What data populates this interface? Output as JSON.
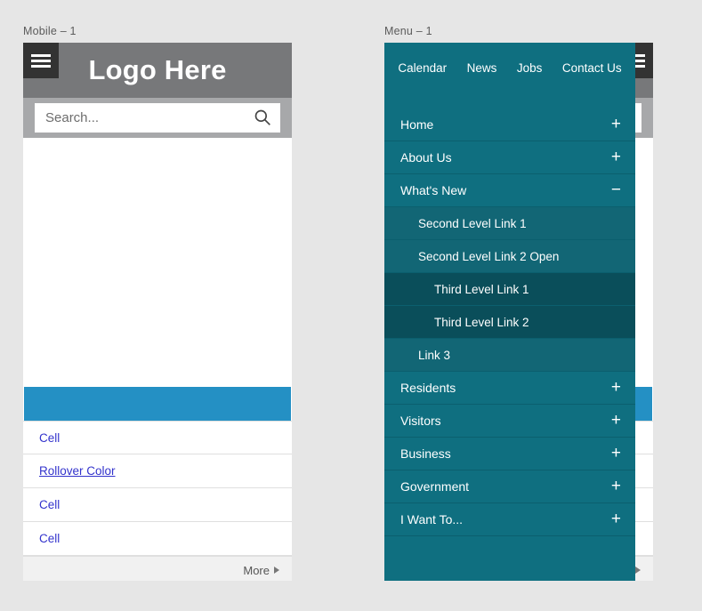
{
  "captions": {
    "mobile": "Mobile – 1",
    "menu": "Menu – 1"
  },
  "colors": {
    "teal": "#0f6f80",
    "teal_level2": "#126675",
    "teal_level3": "#0a4e5a",
    "header_gray": "#77787a",
    "search_band_gray": "#a7a8aa",
    "hamburger_dark": "#333333",
    "accent_blue": "#2490c4",
    "link_blue": "#3333cc",
    "page_bg": "#e6e6e6"
  },
  "mockup": {
    "hamburger_label": "menu",
    "logo": "Logo Here",
    "search": {
      "value": "",
      "placeholder": "Search..."
    },
    "cells": [
      {
        "label": "Cell",
        "rollover": false
      },
      {
        "label": "Rollover Color",
        "rollover": true
      },
      {
        "label": "Cell",
        "rollover": false
      },
      {
        "label": "Cell",
        "rollover": false
      }
    ],
    "more_label": "More"
  },
  "menu": {
    "top_links": [
      "Calendar",
      "News",
      "Jobs",
      "Contact Us"
    ],
    "items": [
      {
        "label": "Home",
        "level": 1,
        "toggle": "+"
      },
      {
        "label": "About Us",
        "level": 1,
        "toggle": "+"
      },
      {
        "label": "What's New",
        "level": 1,
        "toggle": "−"
      },
      {
        "label": "Second Level Link 1",
        "level": 2,
        "toggle": ""
      },
      {
        "label": "Second Level Link 2 Open",
        "level": 2,
        "toggle": ""
      },
      {
        "label": "Third Level Link 1",
        "level": 3,
        "toggle": ""
      },
      {
        "label": "Third Level Link 2",
        "level": 3,
        "toggle": ""
      },
      {
        "label": "Link 3",
        "level": 2,
        "toggle": ""
      },
      {
        "label": "Residents",
        "level": 1,
        "toggle": "+"
      },
      {
        "label": "Visitors",
        "level": 1,
        "toggle": "+"
      },
      {
        "label": "Business",
        "level": 1,
        "toggle": "+"
      },
      {
        "label": "Government",
        "level": 1,
        "toggle": "+"
      },
      {
        "label": "I Want To...",
        "level": 1,
        "toggle": "+"
      }
    ]
  }
}
